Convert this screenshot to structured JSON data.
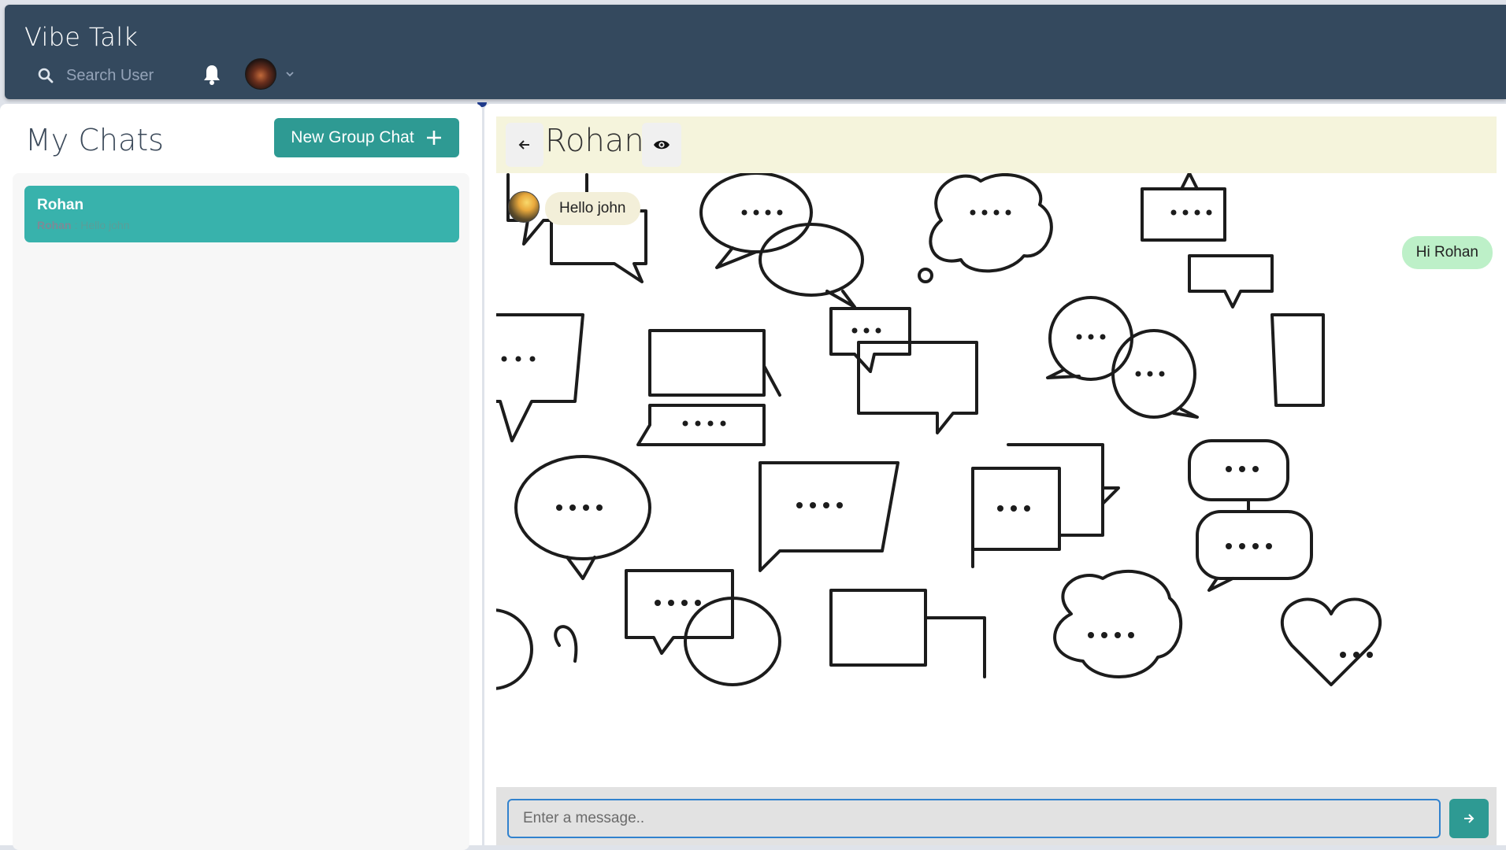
{
  "app": {
    "title": "Vibe Talk"
  },
  "header": {
    "search_label": "Search User",
    "icons": {
      "search": "search-icon",
      "bell": "bell-icon",
      "avatar": "user-avatar",
      "chevron": "chevron-down-icon"
    }
  },
  "sidebar": {
    "title": "My Chats",
    "new_group_label": "New Group Chat",
    "chats": [
      {
        "name": "Rohan",
        "preview_sender": "Rohan",
        "preview_sep": " : ",
        "preview_text": "Hello john",
        "selected": true
      }
    ]
  },
  "chat": {
    "title": "Rohan",
    "messages": [
      {
        "from": "other",
        "text": "Hello john"
      },
      {
        "from": "me",
        "text": "Hi Rohan"
      }
    ],
    "input_placeholder": "Enter a message.."
  },
  "colors": {
    "header_bg": "#34495e",
    "accent_teal": "#2e9a93",
    "selected_chat": "#38b2ac",
    "chat_header_bg": "#f5f4dc",
    "incoming_bubble": "#f3efd9",
    "outgoing_bubble": "#bdf0c8",
    "input_border": "#3182ce"
  }
}
